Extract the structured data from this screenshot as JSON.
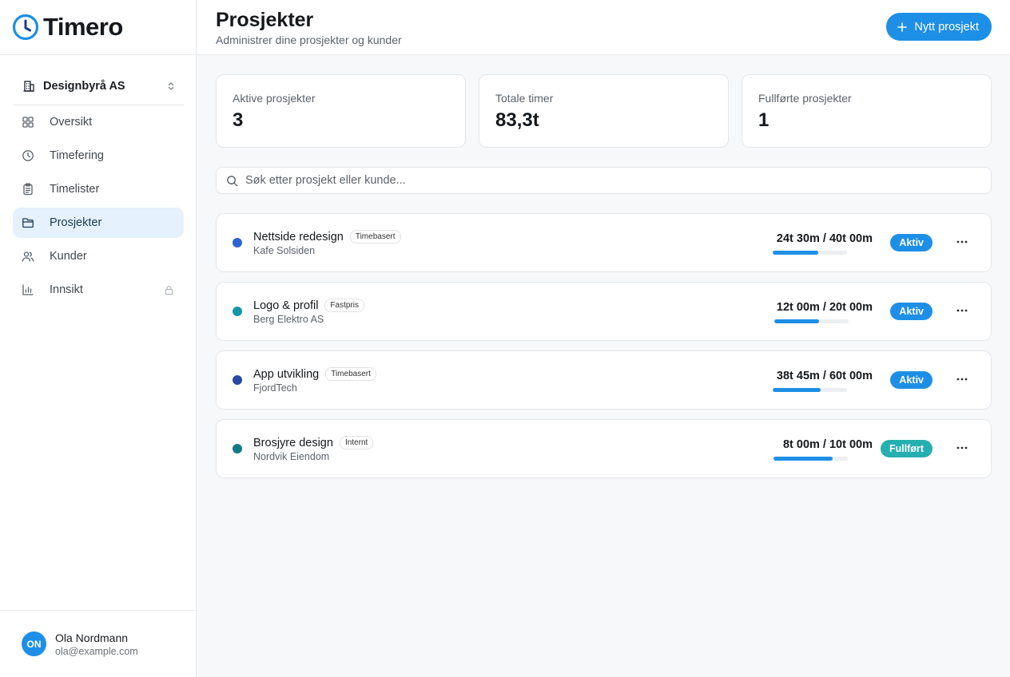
{
  "app": {
    "name": "Timero"
  },
  "org": {
    "name": "Designbyrå AS"
  },
  "nav": [
    {
      "label": "Oversikt",
      "icon": "grid-icon"
    },
    {
      "label": "Timefering",
      "icon": "clock-icon"
    },
    {
      "label": "Timelister",
      "icon": "clipboard-icon"
    },
    {
      "label": "Prosjekter",
      "icon": "folder-icon",
      "active": true
    },
    {
      "label": "Kunder",
      "icon": "users-icon"
    },
    {
      "label": "Innsikt",
      "icon": "bar-chart-icon",
      "locked": true
    }
  ],
  "user": {
    "initials": "ON",
    "name": "Ola Nordmann",
    "email": "ola@example.com"
  },
  "header": {
    "title": "Prosjekter",
    "subtitle": "Administrer dine prosjekter og kunder",
    "new_button": "Nytt prosjekt"
  },
  "stats": [
    {
      "label": "Aktive prosjekter",
      "value": "3"
    },
    {
      "label": "Totale timer",
      "value": "83,3t"
    },
    {
      "label": "Fullførte prosjekter",
      "value": "1"
    }
  ],
  "search": {
    "placeholder": "Søk etter prosjekt eller kunde..."
  },
  "projects": [
    {
      "name": "Nettside redesign",
      "tag": "Timebasert",
      "client": "Kafe Solsiden",
      "hours": "24t 30m / 40t 00m",
      "progress": 0.61,
      "status": "Aktiv",
      "dot_color": "#2f62d6",
      "status_color": "#1e8fe6"
    },
    {
      "name": "Logo & profil",
      "tag": "Fastpris",
      "client": "Berg Elektro AS",
      "hours": "12t 00m / 20t 00m",
      "progress": 0.6,
      "status": "Aktiv",
      "dot_color": "#1596a8",
      "status_color": "#1e8fe6"
    },
    {
      "name": "App utvikling",
      "tag": "Timebasert",
      "client": "FjordTech",
      "hours": "38t 45m / 60t 00m",
      "progress": 0.65,
      "status": "Aktiv",
      "dot_color": "#2849a0",
      "status_color": "#1e8fe6"
    },
    {
      "name": "Brosjyre design",
      "tag": "Internt",
      "client": "Nordvik Eiendom",
      "hours": "8t 00m / 10t 00m",
      "progress": 0.8,
      "status": "Fullført",
      "dot_color": "#137a86",
      "status_color": "#26afb0"
    }
  ]
}
